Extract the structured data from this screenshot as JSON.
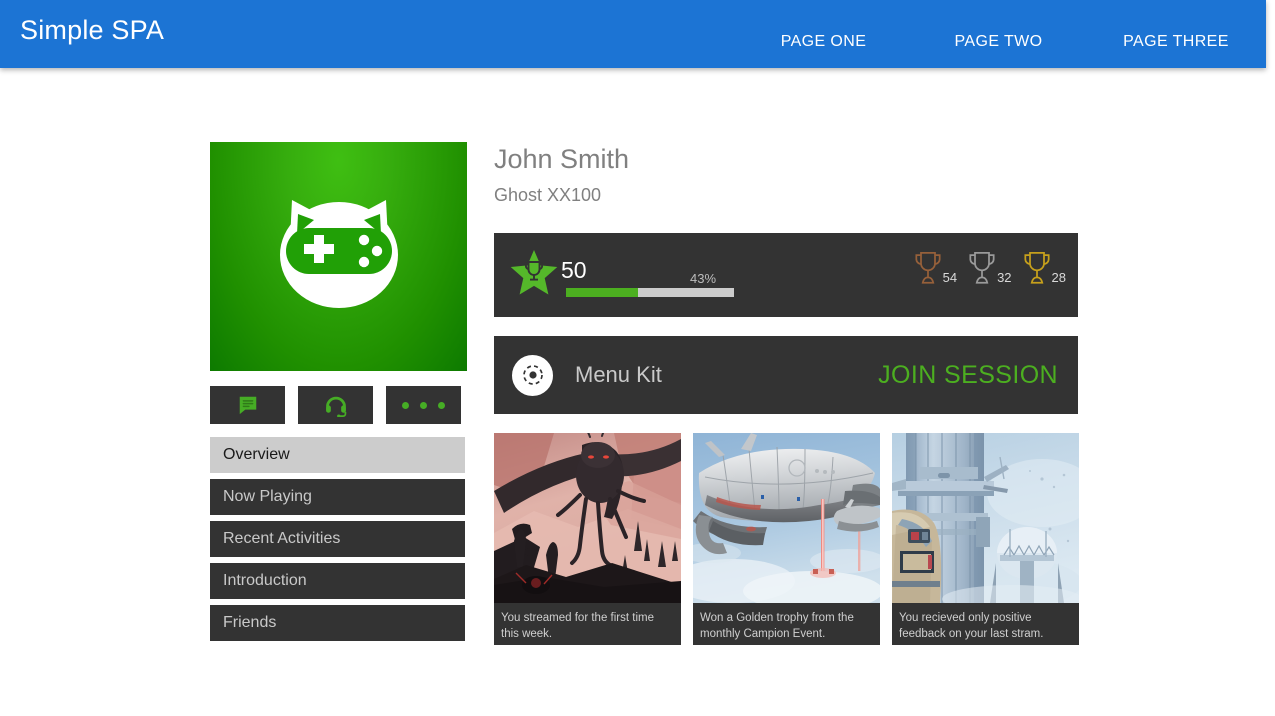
{
  "header": {
    "brand": "Simple SPA",
    "nav": [
      {
        "label": "PAGE ONE",
        "name": "nav-page-one"
      },
      {
        "label": "PAGE TWO",
        "name": "nav-page-two"
      },
      {
        "label": "PAGE THREE",
        "name": "nav-page-three"
      }
    ],
    "background_color": "#1c74d4"
  },
  "profile": {
    "name": "John Smith",
    "handle": "Ghost XX100",
    "avatar": {
      "icon": "gamer-cat-gamepad-icon",
      "background_color": "#2ba40a"
    }
  },
  "quick_actions": [
    {
      "name": "message-button",
      "icon": "chat-bubble-icon"
    },
    {
      "name": "voice-chat-button",
      "icon": "headset-icon"
    },
    {
      "name": "more-options-button",
      "icon": "ellipsis-icon"
    }
  ],
  "side_nav": {
    "items": [
      {
        "label": "Overview",
        "name": "sidebar-item-overview",
        "active": true
      },
      {
        "label": "Now Playing",
        "name": "sidebar-item-now-playing",
        "active": false
      },
      {
        "label": "Recent Activities",
        "name": "sidebar-item-recent-activities",
        "active": false
      },
      {
        "label": "Introduction",
        "name": "sidebar-item-introduction",
        "active": false
      },
      {
        "label": "Friends",
        "name": "sidebar-item-friends",
        "active": false
      }
    ]
  },
  "stats": {
    "level": "50",
    "progress_percent_label": "43%",
    "progress_percent_value": 43,
    "star_icon": "star-trophy-icon",
    "accent_color": "#4caf20",
    "trophies": [
      {
        "tier": "bronze",
        "count": "54",
        "color": "#96603a",
        "icon": "trophy-icon"
      },
      {
        "tier": "silver",
        "count": "32",
        "color": "#9a9a9a",
        "icon": "trophy-icon"
      },
      {
        "tier": "gold",
        "count": "28",
        "color": "#c6a01c",
        "icon": "trophy-icon"
      }
    ]
  },
  "session": {
    "icon": "disc-target-icon",
    "title": "Menu Kit",
    "join_label": "JOIN SESSION",
    "join_color": "#4caf20"
  },
  "activity_cards": [
    {
      "name": "activity-card-streamed",
      "image": "alien-creature-red-landscape-artwork",
      "caption": "You streamed for the first time this week."
    },
    {
      "name": "activity-card-trophy",
      "image": "silver-spaceship-blue-sky-artwork",
      "caption": "Won a Golden trophy from the monthly Campion Event."
    },
    {
      "name": "activity-card-feedback",
      "image": "blue-sci-fi-tower-dome-artwork",
      "caption": "You recieved only positive feedback on your last stram."
    }
  ]
}
